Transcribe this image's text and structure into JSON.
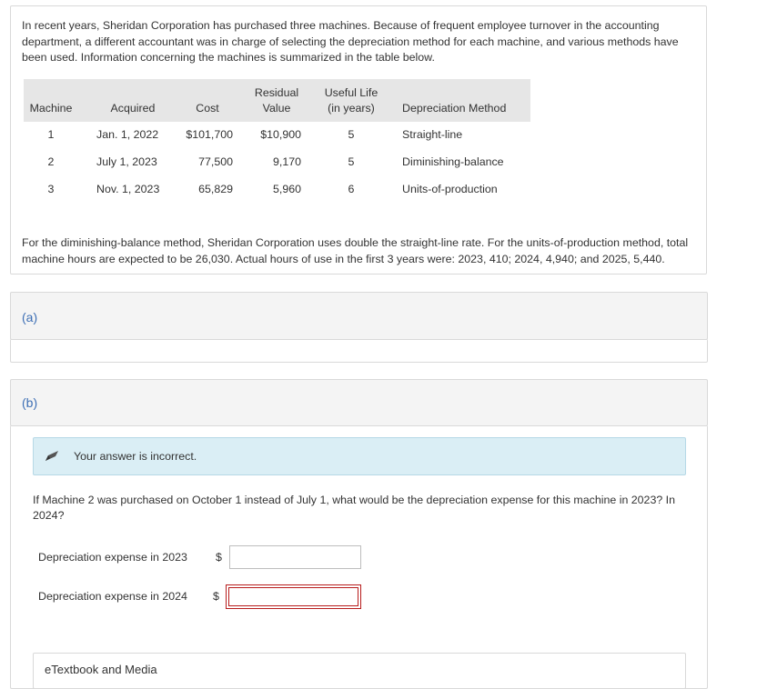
{
  "intro": "In recent years, Sheridan Corporation has purchased three machines. Because of frequent employee turnover in the accounting department, a different accountant was in charge of selecting the depreciation method for each machine, and various methods have been used. Information concerning the machines is summarized in the table below.",
  "table": {
    "headers": {
      "machine": "Machine",
      "acquired": "Acquired",
      "cost": "Cost",
      "residual_1": "Residual",
      "residual_2": "Value",
      "life_1": "Useful Life",
      "life_2": "(in years)",
      "method": "Depreciation Method"
    },
    "rows": [
      {
        "machine": "1",
        "acquired": "Jan. 1, 2022",
        "cost": "$101,700",
        "residual": "$10,900",
        "life": "5",
        "method": "Straight-line"
      },
      {
        "machine": "2",
        "acquired": "July 1, 2023",
        "cost": "77,500",
        "residual": "9,170",
        "life": "5",
        "method": "Diminishing-balance"
      },
      {
        "machine": "3",
        "acquired": "Nov. 1, 2023",
        "cost": "65,829",
        "residual": "5,960",
        "life": "6",
        "method": "Units-of-production"
      }
    ]
  },
  "note": "For the diminishing-balance method, Sheridan Corporation uses double the straight-line rate. For the units-of-production method, total machine hours are expected to be 26,030. Actual hours of use in the first 3 years were: 2023, 410; 2024, 4,940; and 2025, 5,440.",
  "parts": {
    "a_label": "(a)",
    "b_label": "(b)"
  },
  "alert": {
    "message": "Your answer is incorrect."
  },
  "question": "If Machine 2 was purchased on October 1 instead of July 1, what would be the depreciation expense for this machine in 2023? In 2024?",
  "answers": {
    "row1_label": "Depreciation expense in 2023",
    "row2_label": "Depreciation expense in 2024",
    "currency": "$",
    "row1_value": "",
    "row2_value": ""
  },
  "etextbook": "eTextbook and Media",
  "colors": {
    "part_label": "#3d6fb5",
    "alert_bg": "#daeef5",
    "error_border": "#b71c1c",
    "table_header_bg": "#e6e6e6"
  }
}
